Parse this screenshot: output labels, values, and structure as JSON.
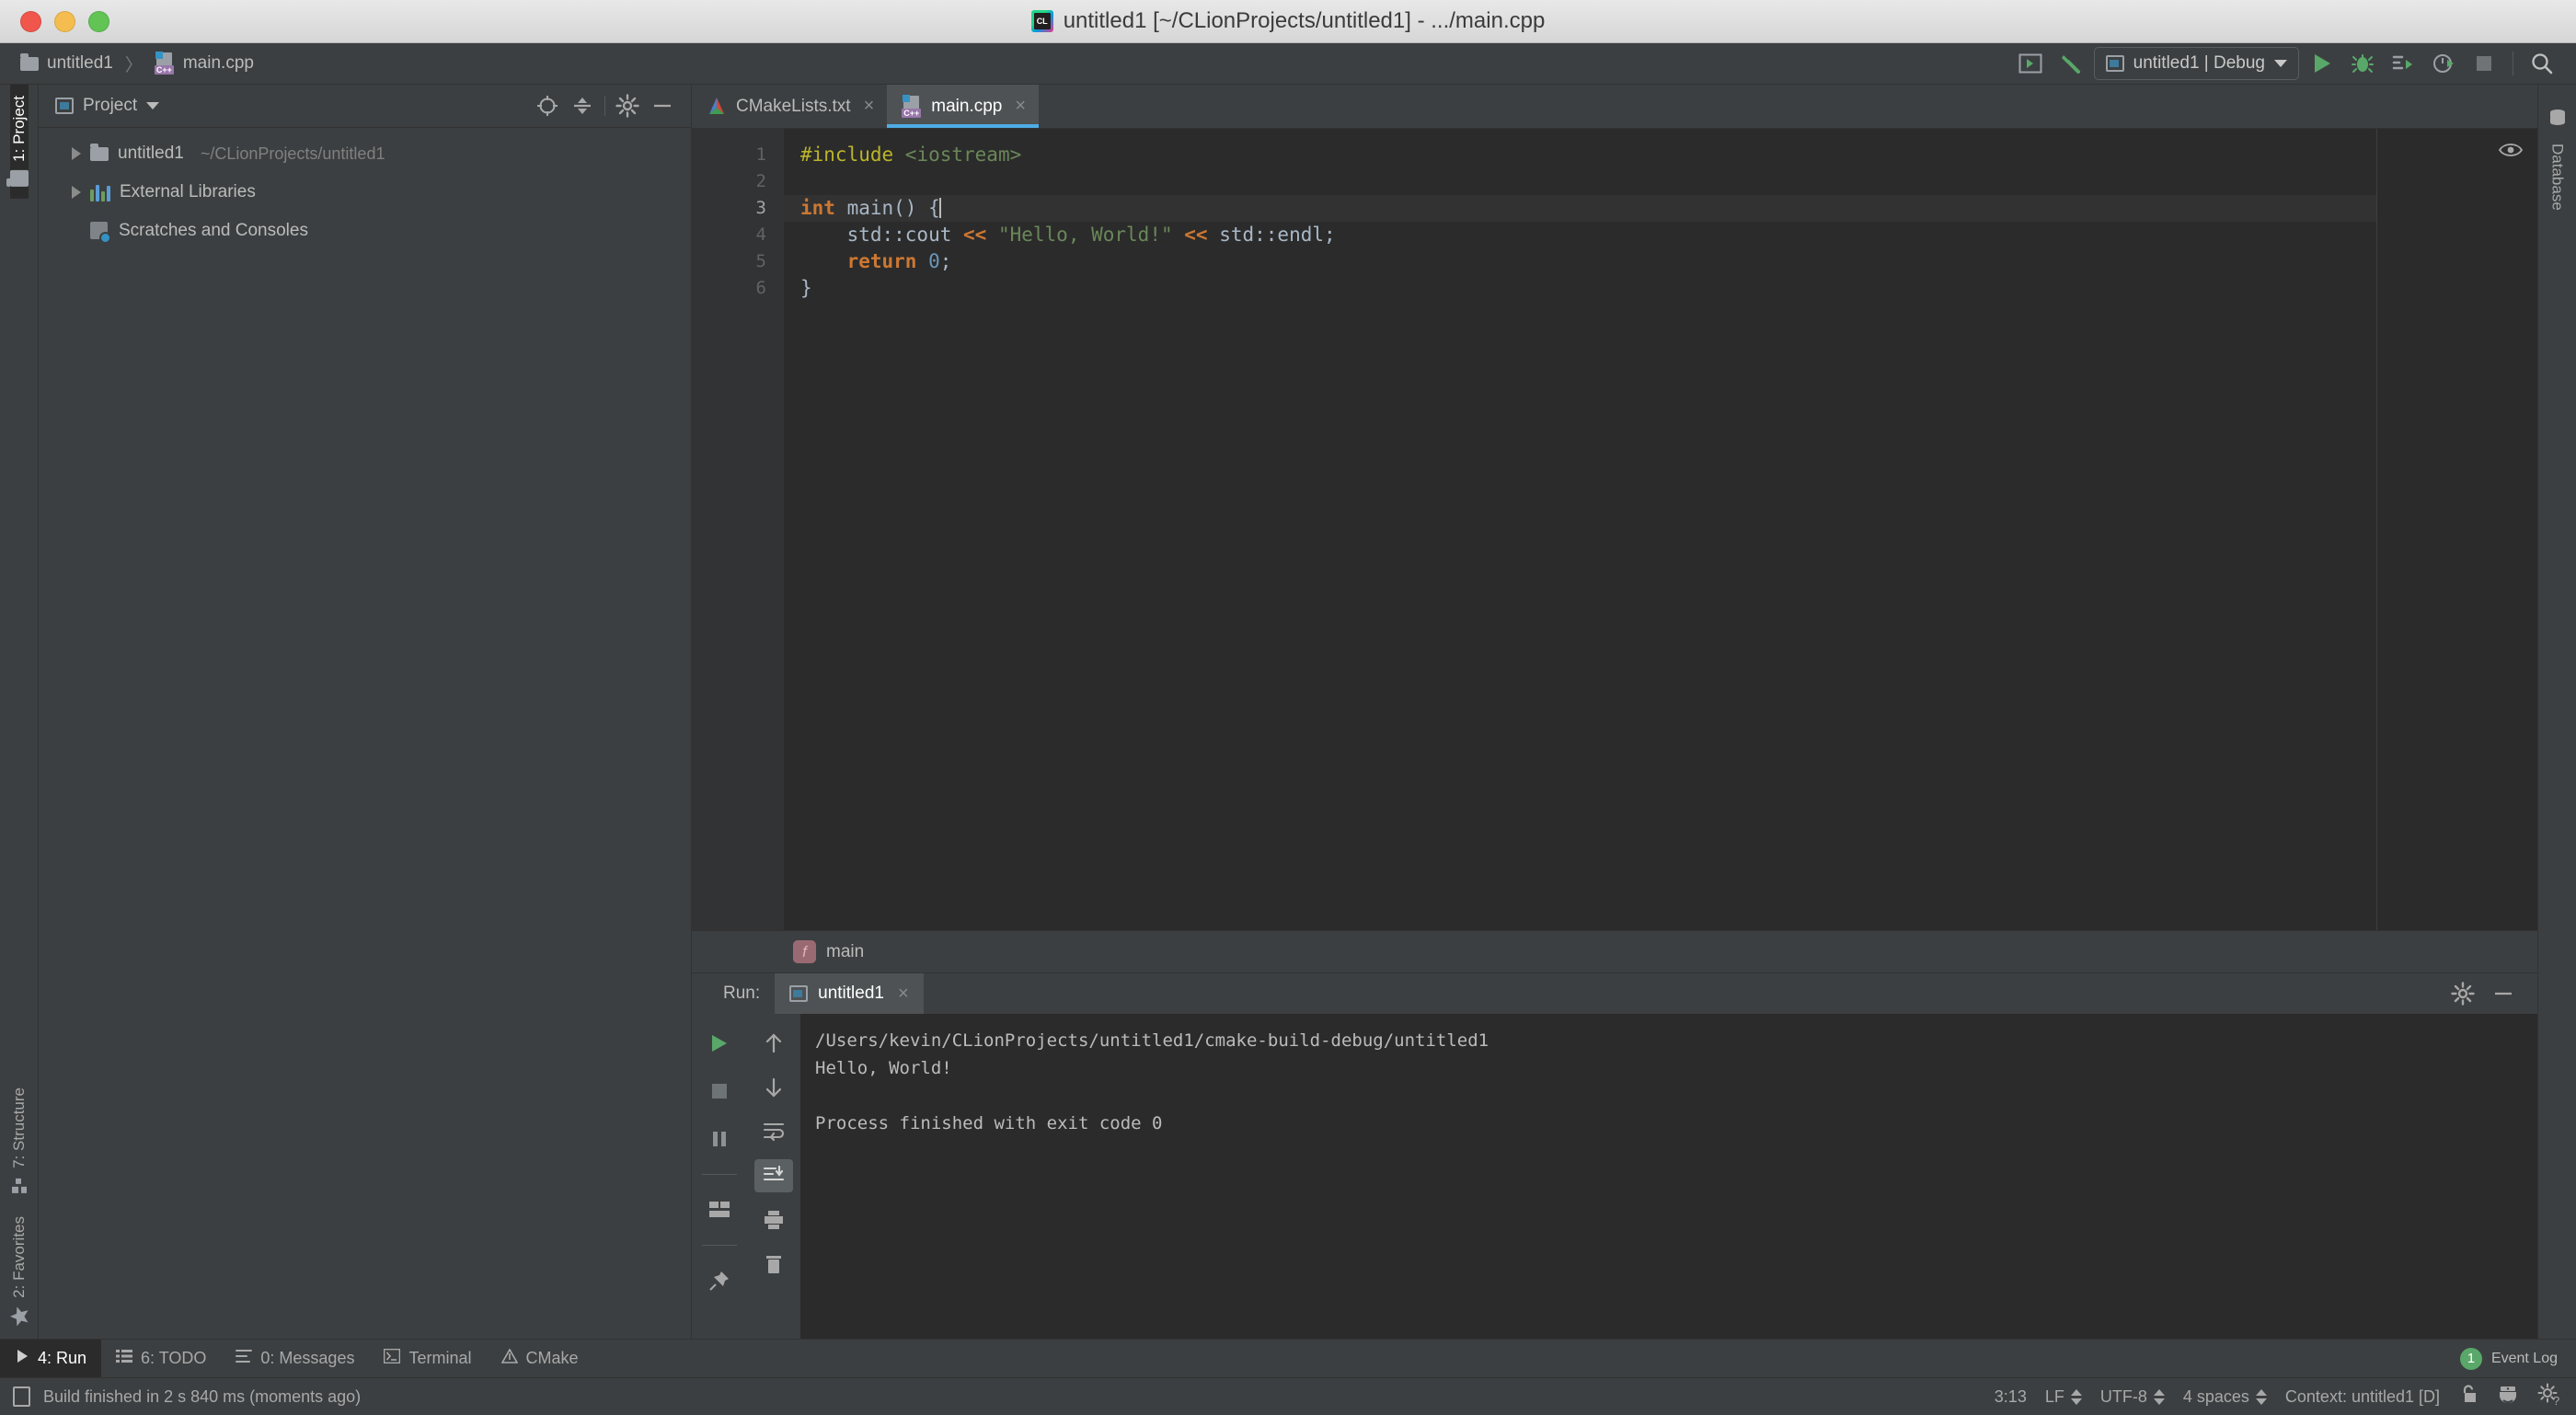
{
  "window": {
    "title": "untitled1 [~/CLionProjects/untitled1] - .../main.cpp",
    "app_icon": "clion-logo"
  },
  "navbar": {
    "breadcrumbs": [
      {
        "label": "untitled1",
        "icon": "folder-icon"
      },
      {
        "label": "main.cpp",
        "icon": "cpp-file-icon"
      }
    ],
    "separator": "〉",
    "toolbar": {
      "hide_windows_label": "",
      "build_label": "",
      "run_config": "untitled1 | Debug",
      "buttons": [
        "show-hide-tool-windows-icon",
        "build-hammer-icon",
        "run-icon",
        "debug-icon",
        "run-with-coverage-icon",
        "profile-icon",
        "stop-icon",
        "search-everywhere-icon"
      ]
    }
  },
  "left_strip": {
    "top": [
      {
        "label": "1: Project",
        "accel": "1",
        "icon": "folder-icon",
        "active": true
      }
    ],
    "bottom": [
      {
        "label": "7: Structure",
        "accel": "7",
        "icon": "structure-icon",
        "active": false
      },
      {
        "label": "2: Favorites",
        "accel": "2",
        "icon": "star-icon",
        "active": false
      }
    ]
  },
  "right_strip": {
    "items": [
      {
        "label": "Database",
        "icon": "database-icon"
      }
    ]
  },
  "project_panel": {
    "title": "Project",
    "dropdown_caret": "▾",
    "actions": [
      "locate-icon",
      "collapse-all-icon",
      "settings-gear-icon",
      "hide-icon"
    ],
    "tree": [
      {
        "label": "untitled1",
        "path": "~/CLionProjects/untitled1",
        "icon": "folder-icon",
        "expandable": true
      },
      {
        "label": "External Libraries",
        "path": "",
        "icon": "libraries-icon",
        "expandable": true
      },
      {
        "label": "Scratches and Consoles",
        "path": "",
        "icon": "scratches-icon",
        "expandable": false
      }
    ]
  },
  "editor": {
    "tabs": [
      {
        "label": "CMakeLists.txt",
        "icon": "cmake-icon",
        "active": false,
        "close": "×"
      },
      {
        "label": "main.cpp",
        "icon": "cpp-file-icon",
        "active": true,
        "close": "×"
      }
    ],
    "line_numbers": [
      "1",
      "2",
      "3",
      "4",
      "5",
      "6"
    ],
    "current_line": 3,
    "code_lines": [
      {
        "n": 1,
        "tokens": [
          {
            "t": "#include ",
            "c": "pre"
          },
          {
            "t": "<iostream>",
            "c": "inc"
          }
        ]
      },
      {
        "n": 2,
        "tokens": []
      },
      {
        "n": 3,
        "tokens": [
          {
            "t": "int",
            "c": "kw"
          },
          {
            "t": " main() {",
            "c": "pl"
          }
        ],
        "caret": true
      },
      {
        "n": 4,
        "tokens": [
          {
            "t": "    std::cout ",
            "c": "pl"
          },
          {
            "t": "<<",
            "c": "kw"
          },
          {
            "t": " ",
            "c": "pl"
          },
          {
            "t": "\"Hello, World!\"",
            "c": "str"
          },
          {
            "t": " ",
            "c": "pl"
          },
          {
            "t": "<<",
            "c": "kw"
          },
          {
            "t": " std::endl;",
            "c": "pl"
          }
        ]
      },
      {
        "n": 5,
        "tokens": [
          {
            "t": "    ",
            "c": "pl"
          },
          {
            "t": "return",
            "c": "kw"
          },
          {
            "t": " ",
            "c": "pl"
          },
          {
            "t": "0",
            "c": "num"
          },
          {
            "t": ";",
            "c": "pl"
          }
        ]
      },
      {
        "n": 6,
        "tokens": [
          {
            "t": "}",
            "c": "pl"
          }
        ]
      }
    ],
    "function_breadcrumb": {
      "label": "main",
      "icon": "function-icon",
      "badge": "f"
    },
    "preview_icon": "eye-icon"
  },
  "run_panel": {
    "label": "Run:",
    "tab": {
      "label": "untitled1",
      "icon": "run-config-icon",
      "close": "×"
    },
    "header_actions": [
      "settings-gear-icon",
      "hide-icon"
    ],
    "gutter_left": [
      "rerun-icon",
      "stop-icon",
      "pause-icon",
      "layout-icon",
      "pin-icon"
    ],
    "gutter_right": [
      "up-arrow-icon",
      "down-arrow-icon",
      "soft-wrap-icon",
      "scroll-to-end-icon",
      "print-icon",
      "trash-icon"
    ],
    "console_text": "/Users/kevin/CLionProjects/untitled1/cmake-build-debug/untitled1\nHello, World!\n\nProcess finished with exit code 0"
  },
  "bottom_bar": {
    "tabs": [
      {
        "label": "4: Run",
        "accel": "4",
        "rest": ": Run",
        "icon": "play-icon",
        "active": true
      },
      {
        "label": "6: TODO",
        "accel": "6",
        "rest": ": TODO",
        "icon": "todo-list-icon",
        "active": false
      },
      {
        "label": "0: Messages",
        "accel": "0",
        "rest": ": Messages",
        "icon": "messages-icon",
        "active": false
      },
      {
        "label": "Terminal",
        "accel": "",
        "rest": "Terminal",
        "icon": "terminal-icon",
        "active": false
      },
      {
        "label": "CMake",
        "accel": "",
        "rest": "CMake",
        "icon": "cmake-icon",
        "active": false
      }
    ],
    "event_log": {
      "label": "Event Log",
      "count": "1"
    }
  },
  "status_bar": {
    "message": "Build finished in 2 s 840 ms (moments ago)",
    "message_icon": "book-icon",
    "caret_position": "3:13",
    "line_separator": "LF",
    "encoding": "UTF-8",
    "indent": "4 spaces",
    "context": "Context: untitled1 [D]",
    "right_icons": [
      "unlock-icon",
      "inspector-icon",
      "settings-help-icon"
    ]
  }
}
